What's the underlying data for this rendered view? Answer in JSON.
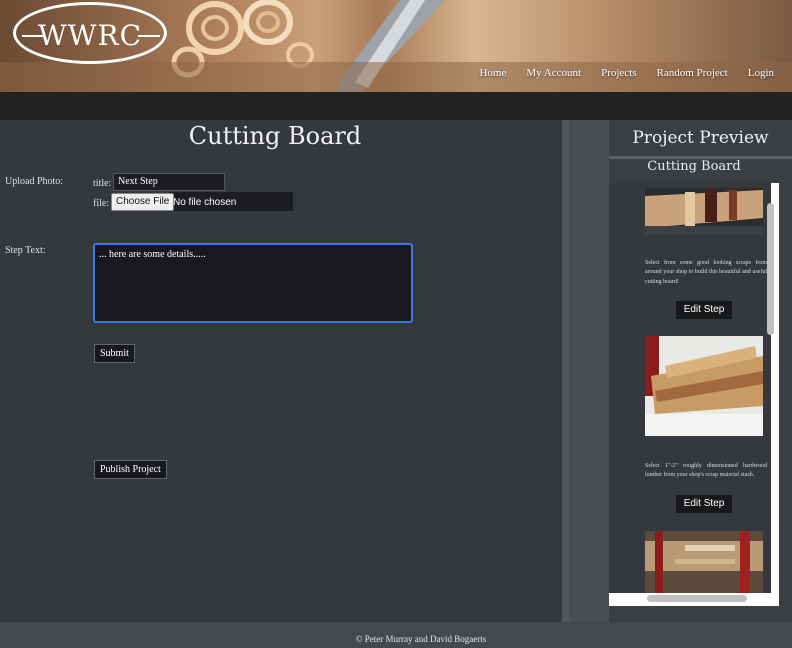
{
  "header": {
    "logo_text": "WWRC",
    "nav": [
      "Home",
      "My Account",
      "Projects",
      "Random Project",
      "Login"
    ]
  },
  "main": {
    "title": "Cutting Board",
    "upload_label": "Upload Photo:",
    "title_label": "title:",
    "title_value": "Next Step",
    "file_label": "file:",
    "file_button": "Choose File",
    "file_status": "No file chosen",
    "step_text_label": "Step Text:",
    "step_text_value": "... here are some details.....",
    "submit_label": "Submit",
    "publish_label": "Publish Project"
  },
  "preview": {
    "heading": "Project Preview",
    "project_title": "Cutting Board",
    "steps": [
      {
        "text": "Select from some good looking scraps from around your shop to build this beautiful and useful cutting board!",
        "button": "Edit Step"
      },
      {
        "text": "Select 1\"-2\" roughly dimensioned hardwood lumber from your shop's scrap material stash.",
        "button": "Edit Step"
      }
    ]
  },
  "footer": {
    "copyright": "© Peter Murray and David Bogaerts"
  },
  "colors": {
    "page_bg": "#35383c",
    "dark_bar": "#212323",
    "focus_border": "#3b78e7"
  }
}
